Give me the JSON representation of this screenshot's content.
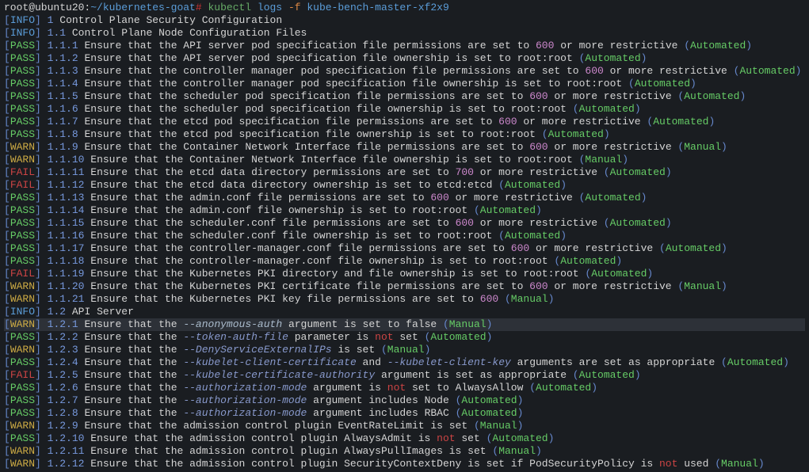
{
  "prompt": {
    "userHost": "root@ubuntu20",
    "path": "~/kubernetes-goat",
    "hash": "#",
    "command": "kubectl",
    "sub": "logs",
    "flag": "-f",
    "target": " kube-bench-master-xf2x9"
  },
  "rows": [
    {
      "level": "INFO",
      "sec": "1",
      "parts": [
        {
          "t": "info",
          "v": "Control Plane Security Configuration"
        }
      ]
    },
    {
      "level": "INFO",
      "sec": "1.1",
      "parts": [
        {
          "t": "info",
          "v": "Control Plane Node Configuration Files"
        }
      ]
    },
    {
      "level": "PASS",
      "sec": "1.1.1",
      "parts": [
        {
          "t": "text",
          "v": "Ensure that the API server pod specification file permissions are set to "
        },
        {
          "t": "num",
          "v": "600"
        },
        {
          "t": "text",
          "v": " or more restrictive "
        },
        {
          "t": "parens",
          "v": "("
        },
        {
          "t": "mode",
          "v": "Automated"
        },
        {
          "t": "parens",
          "v": ")"
        }
      ]
    },
    {
      "level": "PASS",
      "sec": "1.1.2",
      "parts": [
        {
          "t": "text",
          "v": "Ensure that the API server pod specification file ownership is set to root:root "
        },
        {
          "t": "parens",
          "v": "("
        },
        {
          "t": "mode",
          "v": "Automated"
        },
        {
          "t": "parens",
          "v": ")"
        }
      ]
    },
    {
      "level": "PASS",
      "sec": "1.1.3",
      "parts": [
        {
          "t": "text",
          "v": "Ensure that the controller manager pod specification file permissions are set to "
        },
        {
          "t": "num",
          "v": "600"
        },
        {
          "t": "text",
          "v": " or more restrictive "
        },
        {
          "t": "parens",
          "v": "("
        },
        {
          "t": "mode",
          "v": "Automated"
        },
        {
          "t": "parens",
          "v": ")"
        }
      ]
    },
    {
      "level": "PASS",
      "sec": "1.1.4",
      "parts": [
        {
          "t": "text",
          "v": "Ensure that the controller manager pod specification file ownership is set to root:root "
        },
        {
          "t": "parens",
          "v": "("
        },
        {
          "t": "mode",
          "v": "Automated"
        },
        {
          "t": "parens",
          "v": ")"
        }
      ]
    },
    {
      "level": "PASS",
      "sec": "1.1.5",
      "parts": [
        {
          "t": "text",
          "v": "Ensure that the scheduler pod specification file permissions are set to "
        },
        {
          "t": "num",
          "v": "600"
        },
        {
          "t": "text",
          "v": " or more restrictive "
        },
        {
          "t": "parens",
          "v": "("
        },
        {
          "t": "mode",
          "v": "Automated"
        },
        {
          "t": "parens",
          "v": ")"
        }
      ]
    },
    {
      "level": "PASS",
      "sec": "1.1.6",
      "parts": [
        {
          "t": "text",
          "v": "Ensure that the scheduler pod specification file ownership is set to root:root "
        },
        {
          "t": "parens",
          "v": "("
        },
        {
          "t": "mode",
          "v": "Automated"
        },
        {
          "t": "parens",
          "v": ")"
        }
      ]
    },
    {
      "level": "PASS",
      "sec": "1.1.7",
      "parts": [
        {
          "t": "text",
          "v": "Ensure that the etcd pod specification file permissions are set to "
        },
        {
          "t": "num",
          "v": "600"
        },
        {
          "t": "text",
          "v": " or more restrictive "
        },
        {
          "t": "parens",
          "v": "("
        },
        {
          "t": "mode",
          "v": "Automated"
        },
        {
          "t": "parens",
          "v": ")"
        }
      ]
    },
    {
      "level": "PASS",
      "sec": "1.1.8",
      "parts": [
        {
          "t": "text",
          "v": "Ensure that the etcd pod specification file ownership is set to root:root "
        },
        {
          "t": "parens",
          "v": "("
        },
        {
          "t": "mode",
          "v": "Automated"
        },
        {
          "t": "parens",
          "v": ")"
        }
      ]
    },
    {
      "level": "WARN",
      "sec": "1.1.9",
      "parts": [
        {
          "t": "text",
          "v": "Ensure that the Container Network Interface file permissions are set to "
        },
        {
          "t": "num",
          "v": "600"
        },
        {
          "t": "text",
          "v": " or more restrictive "
        },
        {
          "t": "parens",
          "v": "("
        },
        {
          "t": "mode",
          "v": "Manual"
        },
        {
          "t": "parens",
          "v": ")"
        }
      ]
    },
    {
      "level": "WARN",
      "sec": "1.1.10",
      "parts": [
        {
          "t": "text",
          "v": "Ensure that the Container Network Interface file ownership is set to root:root "
        },
        {
          "t": "parens",
          "v": "("
        },
        {
          "t": "mode",
          "v": "Manual"
        },
        {
          "t": "parens",
          "v": ")"
        }
      ]
    },
    {
      "level": "FAIL",
      "sec": "1.1.11",
      "parts": [
        {
          "t": "text",
          "v": "Ensure that the etcd data directory permissions are set to "
        },
        {
          "t": "num",
          "v": "700"
        },
        {
          "t": "text",
          "v": " or more restrictive "
        },
        {
          "t": "parens",
          "v": "("
        },
        {
          "t": "mode",
          "v": "Automated"
        },
        {
          "t": "parens",
          "v": ")"
        }
      ]
    },
    {
      "level": "FAIL",
      "sec": "1.1.12",
      "parts": [
        {
          "t": "text",
          "v": "Ensure that the etcd data directory ownership is set to etcd:etcd "
        },
        {
          "t": "parens",
          "v": "("
        },
        {
          "t": "mode",
          "v": "Automated"
        },
        {
          "t": "parens",
          "v": ")"
        }
      ]
    },
    {
      "level": "PASS",
      "sec": "1.1.13",
      "parts": [
        {
          "t": "text",
          "v": "Ensure that the admin.conf file permissions are set to "
        },
        {
          "t": "num",
          "v": "600"
        },
        {
          "t": "text",
          "v": " or more restrictive "
        },
        {
          "t": "parens",
          "v": "("
        },
        {
          "t": "mode",
          "v": "Automated"
        },
        {
          "t": "parens",
          "v": ")"
        }
      ]
    },
    {
      "level": "PASS",
      "sec": "1.1.14",
      "parts": [
        {
          "t": "text",
          "v": "Ensure that the admin.conf file ownership is set to root:root "
        },
        {
          "t": "parens",
          "v": "("
        },
        {
          "t": "mode",
          "v": "Automated"
        },
        {
          "t": "parens",
          "v": ")"
        }
      ]
    },
    {
      "level": "PASS",
      "sec": "1.1.15",
      "parts": [
        {
          "t": "text",
          "v": "Ensure that the scheduler.conf file permissions are set to "
        },
        {
          "t": "num",
          "v": "600"
        },
        {
          "t": "text",
          "v": " or more restrictive "
        },
        {
          "t": "parens",
          "v": "("
        },
        {
          "t": "mode",
          "v": "Automated"
        },
        {
          "t": "parens",
          "v": ")"
        }
      ]
    },
    {
      "level": "PASS",
      "sec": "1.1.16",
      "parts": [
        {
          "t": "text",
          "v": "Ensure that the scheduler.conf file ownership is set to root:root "
        },
        {
          "t": "parens",
          "v": "("
        },
        {
          "t": "mode",
          "v": "Automated"
        },
        {
          "t": "parens",
          "v": ")"
        }
      ]
    },
    {
      "level": "PASS",
      "sec": "1.1.17",
      "parts": [
        {
          "t": "text",
          "v": "Ensure that the controller-manager.conf file permissions are set to "
        },
        {
          "t": "num",
          "v": "600"
        },
        {
          "t": "text",
          "v": " or more restrictive "
        },
        {
          "t": "parens",
          "v": "("
        },
        {
          "t": "mode",
          "v": "Automated"
        },
        {
          "t": "parens",
          "v": ")"
        }
      ]
    },
    {
      "level": "PASS",
      "sec": "1.1.18",
      "parts": [
        {
          "t": "text",
          "v": "Ensure that the controller-manager.conf file ownership is set to root:root "
        },
        {
          "t": "parens",
          "v": "("
        },
        {
          "t": "mode",
          "v": "Automated"
        },
        {
          "t": "parens",
          "v": ")"
        }
      ]
    },
    {
      "level": "FAIL",
      "sec": "1.1.19",
      "parts": [
        {
          "t": "text",
          "v": "Ensure that the Kubernetes PKI directory and file ownership is set to root:root "
        },
        {
          "t": "parens",
          "v": "("
        },
        {
          "t": "mode",
          "v": "Automated"
        },
        {
          "t": "parens",
          "v": ")"
        }
      ]
    },
    {
      "level": "WARN",
      "sec": "1.1.20",
      "parts": [
        {
          "t": "text",
          "v": "Ensure that the Kubernetes PKI certificate file permissions are set to "
        },
        {
          "t": "num",
          "v": "600"
        },
        {
          "t": "text",
          "v": " or more restrictive "
        },
        {
          "t": "parens",
          "v": "("
        },
        {
          "t": "mode",
          "v": "Manual"
        },
        {
          "t": "parens",
          "v": ")"
        }
      ]
    },
    {
      "level": "WARN",
      "sec": "1.1.21",
      "parts": [
        {
          "t": "text",
          "v": "Ensure that the Kubernetes PKI key file permissions are set to "
        },
        {
          "t": "num",
          "v": "600"
        },
        {
          "t": "text",
          "v": " "
        },
        {
          "t": "parens",
          "v": "("
        },
        {
          "t": "mode",
          "v": "Manual"
        },
        {
          "t": "parens",
          "v": ")"
        }
      ]
    },
    {
      "level": "INFO",
      "sec": "1.2",
      "parts": [
        {
          "t": "info",
          "v": "API Server"
        }
      ]
    },
    {
      "level": "WARN",
      "sec": "1.2.1",
      "highlighted": true,
      "parts": [
        {
          "t": "text",
          "v": "Ensure that the "
        },
        {
          "t": "opt-light",
          "v": "--anonymous-auth"
        },
        {
          "t": "text",
          "v": " argument is set to false "
        },
        {
          "t": "parens",
          "v": "("
        },
        {
          "t": "mode",
          "v": "Manual"
        },
        {
          "t": "parens",
          "v": ")"
        }
      ]
    },
    {
      "level": "PASS",
      "sec": "1.2.2",
      "parts": [
        {
          "t": "text",
          "v": "Ensure that the "
        },
        {
          "t": "opt",
          "v": "--token-auth-file"
        },
        {
          "t": "text",
          "v": " parameter is "
        },
        {
          "t": "not",
          "v": "not"
        },
        {
          "t": "text",
          "v": " set "
        },
        {
          "t": "parens",
          "v": "("
        },
        {
          "t": "mode",
          "v": "Automated"
        },
        {
          "t": "parens",
          "v": ")"
        }
      ]
    },
    {
      "level": "WARN",
      "sec": "1.2.3",
      "parts": [
        {
          "t": "text",
          "v": "Ensure that the "
        },
        {
          "t": "opt",
          "v": "--DenyServiceExternalIPs"
        },
        {
          "t": "text",
          "v": " is set "
        },
        {
          "t": "parens",
          "v": "("
        },
        {
          "t": "mode",
          "v": "Manual"
        },
        {
          "t": "parens",
          "v": ")"
        }
      ]
    },
    {
      "level": "PASS",
      "sec": "1.2.4",
      "parts": [
        {
          "t": "text",
          "v": "Ensure that the "
        },
        {
          "t": "opt",
          "v": "--kubelet-client-certificate"
        },
        {
          "t": "text",
          "v": " and "
        },
        {
          "t": "opt",
          "v": "--kubelet-client-key"
        },
        {
          "t": "text",
          "v": " arguments are set as appropriate "
        },
        {
          "t": "parens",
          "v": "("
        },
        {
          "t": "mode",
          "v": "Automated"
        },
        {
          "t": "parens",
          "v": ")"
        }
      ]
    },
    {
      "level": "FAIL",
      "sec": "1.2.5",
      "parts": [
        {
          "t": "text",
          "v": "Ensure that the "
        },
        {
          "t": "opt",
          "v": "--kubelet-certificate-authority"
        },
        {
          "t": "text",
          "v": " argument is set as appropriate "
        },
        {
          "t": "parens",
          "v": "("
        },
        {
          "t": "mode",
          "v": "Automated"
        },
        {
          "t": "parens",
          "v": ")"
        }
      ]
    },
    {
      "level": "PASS",
      "sec": "1.2.6",
      "parts": [
        {
          "t": "text",
          "v": "Ensure that the "
        },
        {
          "t": "opt",
          "v": "--authorization-mode"
        },
        {
          "t": "text",
          "v": " argument is "
        },
        {
          "t": "not",
          "v": "not"
        },
        {
          "t": "text",
          "v": " set to AlwaysAllow "
        },
        {
          "t": "parens",
          "v": "("
        },
        {
          "t": "mode",
          "v": "Automated"
        },
        {
          "t": "parens",
          "v": ")"
        }
      ]
    },
    {
      "level": "PASS",
      "sec": "1.2.7",
      "parts": [
        {
          "t": "text",
          "v": "Ensure that the "
        },
        {
          "t": "opt",
          "v": "--authorization-mode"
        },
        {
          "t": "text",
          "v": " argument includes Node "
        },
        {
          "t": "parens",
          "v": "("
        },
        {
          "t": "mode",
          "v": "Automated"
        },
        {
          "t": "parens",
          "v": ")"
        }
      ]
    },
    {
      "level": "PASS",
      "sec": "1.2.8",
      "parts": [
        {
          "t": "text",
          "v": "Ensure that the "
        },
        {
          "t": "opt",
          "v": "--authorization-mode"
        },
        {
          "t": "text",
          "v": " argument includes RBAC "
        },
        {
          "t": "parens",
          "v": "("
        },
        {
          "t": "mode",
          "v": "Automated"
        },
        {
          "t": "parens",
          "v": ")"
        }
      ]
    },
    {
      "level": "WARN",
      "sec": "1.2.9",
      "parts": [
        {
          "t": "text",
          "v": "Ensure that the admission control plugin EventRateLimit is set "
        },
        {
          "t": "parens",
          "v": "("
        },
        {
          "t": "mode",
          "v": "Manual"
        },
        {
          "t": "parens",
          "v": ")"
        }
      ]
    },
    {
      "level": "PASS",
      "sec": "1.2.10",
      "parts": [
        {
          "t": "text",
          "v": "Ensure that the admission control plugin AlwaysAdmit is "
        },
        {
          "t": "not",
          "v": "not"
        },
        {
          "t": "text",
          "v": " set "
        },
        {
          "t": "parens",
          "v": "("
        },
        {
          "t": "mode",
          "v": "Automated"
        },
        {
          "t": "parens",
          "v": ")"
        }
      ]
    },
    {
      "level": "WARN",
      "sec": "1.2.11",
      "parts": [
        {
          "t": "text",
          "v": "Ensure that the admission control plugin AlwaysPullImages is set "
        },
        {
          "t": "parens",
          "v": "("
        },
        {
          "t": "mode",
          "v": "Manual"
        },
        {
          "t": "parens",
          "v": ")"
        }
      ]
    },
    {
      "level": "WARN",
      "sec": "1.2.12",
      "parts": [
        {
          "t": "text",
          "v": "Ensure that the admission control plugin SecurityContextDeny is set if PodSecurityPolicy is "
        },
        {
          "t": "not",
          "v": "not"
        },
        {
          "t": "text",
          "v": " used "
        },
        {
          "t": "parens",
          "v": "("
        },
        {
          "t": "mode",
          "v": "Manual"
        },
        {
          "t": "parens",
          "v": ")"
        }
      ]
    }
  ]
}
